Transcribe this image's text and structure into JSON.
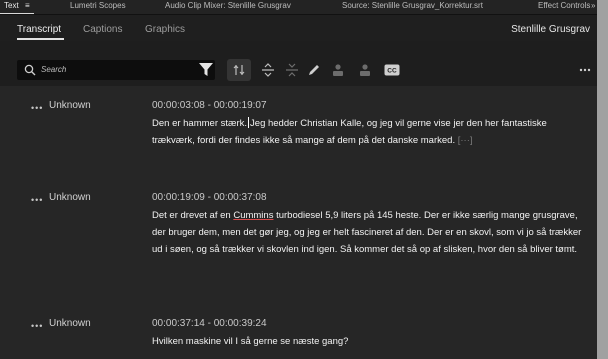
{
  "panel_tabs": {
    "text": "Text",
    "menu_icon": "≡",
    "lumetri": "Lumetri Scopes",
    "audio_mixer": "Audio Clip Mixer: Stenlille Grusgrav",
    "source": "Source: Stenlille Grusgrav_Korrektur.srt",
    "effect_controls": "Effect Controls",
    "overflow": "»"
  },
  "subtabs": {
    "transcript": "Transcript",
    "captions": "Captions",
    "graphics": "Graphics",
    "sequence_name": "Stenlille Grusgrav"
  },
  "search": {
    "placeholder": "Search"
  },
  "toolbar_icons": [
    "search-icon",
    "filter-icon",
    "merge-segments-icon",
    "split-segments-icon",
    "collapse-icon",
    "pencil-icon",
    "speaker-icon",
    "speaker-alt-icon",
    "cc-icon",
    "more-icon"
  ],
  "transcript": [
    {
      "speaker": "Unknown",
      "timecode": "00:00:03:08 - 00:00:19:07",
      "text_before": "Den er hammer stærk.",
      "text_after": "Jeg hedder Christian Kalle, og jeg vil gerne vise jer den her fantastiske trækværk, fordi der findes ikke så mange af dem på det danske marked.",
      "more": "[···]"
    },
    {
      "speaker": "Unknown",
      "timecode": "00:00:19:09 - 00:00:37:08",
      "text_a": "Det er drevet af en",
      "underlined": "Cummins",
      "text_b": "turbodiesel 5,9 liters på 145 heste. Der er ikke særlig mange grusgrave, der bruger dem, men det gør jeg, og jeg er helt fascineret af den. Der er en skovl, som vi jo så trækker ud i søen, og så trækker vi skovlen ind igen. Så kommer det så op af slisken, hvor den så bliver tømt."
    },
    {
      "speaker": "Unknown",
      "timecode": "00:00:37:14 - 00:00:39:24",
      "text": "Hvilken maskine vil I så gerne se næste gang?"
    }
  ],
  "colors": {
    "panel_bg": "#1e1e1e",
    "rows_bg": "#262626",
    "search_bg": "#0d0d0d",
    "underline": "#d84a4a"
  }
}
